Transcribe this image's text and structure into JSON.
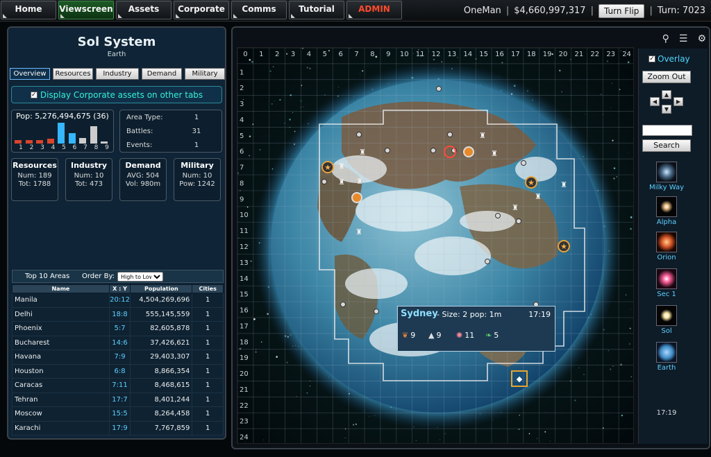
{
  "nav": {
    "items": [
      "Home",
      "Viewscreen",
      "Assets",
      "Corporate",
      "Comms",
      "Tutorial",
      "ADMIN"
    ],
    "active": "Viewscreen",
    "user": "OneMan",
    "money": "$4,660,997,317",
    "turn_flip_label": "Turn Flip",
    "turn_label": "Turn: 7023"
  },
  "left": {
    "title": "Sol System",
    "subtitle": "Earth",
    "tabs": [
      "Overview",
      "Resources",
      "Industry",
      "Demand",
      "Military"
    ],
    "active_tab": "Overview",
    "display_assets_label": "Display Corporate assets on other tabs",
    "pop_label": "Pop: 5,276,494,675 (36)",
    "histogram": {
      "labels": [
        "1",
        "2",
        "3",
        "4",
        "5",
        "6",
        "7",
        "8",
        "9"
      ],
      "values": [
        3,
        3,
        3,
        4,
        18,
        9,
        5,
        15,
        2
      ],
      "colors": [
        "#d8452c",
        "#d8452c",
        "#d8452c",
        "#d8452c",
        "#35b6ff",
        "#35b6ff",
        "#cccccc",
        "#cccccc",
        "#cccccc"
      ]
    },
    "area": {
      "type_label": "Area Type:",
      "type_value": "1",
      "battles_label": "Battles:",
      "battles_value": "31",
      "events_label": "Events:",
      "events_value": "1"
    },
    "stats": {
      "resources": {
        "title": "Resources",
        "line1": "Num: 189",
        "line2": "Tot: 1788"
      },
      "industry": {
        "title": "Industry",
        "line1": "Num: 10",
        "line2": "Tot: 473"
      },
      "demand": {
        "title": "Demand",
        "line1": "AVG: 504",
        "line2": "Vol: 980m"
      },
      "military": {
        "title": "Military",
        "line1": "Num: 10",
        "line2": "Pow: 1242"
      }
    },
    "top_areas": {
      "title": "Top 10 Areas",
      "order_label": "Order By:",
      "order_value": "High to Low",
      "columns": [
        "Name",
        "X : Y",
        "Population",
        "Cities"
      ],
      "rows": [
        {
          "name": "Manila",
          "xy": "20:12",
          "pop": "4,504,269,696",
          "cities": "1"
        },
        {
          "name": "Delhi",
          "xy": "18:8",
          "pop": "555,145,559",
          "cities": "1"
        },
        {
          "name": "Phoenix",
          "xy": "5:7",
          "pop": "82,605,878",
          "cities": "1"
        },
        {
          "name": "Bucharest",
          "xy": "14:6",
          "pop": "37,426,621",
          "cities": "1"
        },
        {
          "name": "Havana",
          "xy": "7:9",
          "pop": "29,403,307",
          "cities": "1"
        },
        {
          "name": "Houston",
          "xy": "6:8",
          "pop": "8,866,354",
          "cities": "1"
        },
        {
          "name": "Caracas",
          "xy": "7:11",
          "pop": "8,468,615",
          "cities": "1"
        },
        {
          "name": "Tehran",
          "xy": "17:7",
          "pop": "8,401,244",
          "cities": "1"
        },
        {
          "name": "Moscow",
          "xy": "15:5",
          "pop": "8,264,458",
          "cities": "1"
        },
        {
          "name": "Karachi",
          "xy": "17:9",
          "pop": "7,767,859",
          "cities": "1"
        }
      ]
    }
  },
  "map": {
    "col_labels": [
      "0",
      "1",
      "2",
      "3",
      "4",
      "5",
      "6",
      "7",
      "8",
      "9",
      "10",
      "11",
      "12",
      "13",
      "14",
      "15",
      "16",
      "17",
      "18",
      "19",
      "20",
      "21",
      "22",
      "23",
      "24"
    ],
    "row_labels": [
      "0",
      "1",
      "2",
      "3",
      "4",
      "5",
      "6",
      "7",
      "8",
      "9",
      "10",
      "11",
      "12",
      "13",
      "14",
      "15",
      "16",
      "17",
      "18",
      "19",
      "20",
      "21",
      "22",
      "23",
      "24"
    ],
    "tooltip": {
      "name": "Sydney",
      "info": "- Size: 2  pop: 1m",
      "time": "17:19",
      "res1": "9",
      "res2": "9",
      "res3": "11",
      "res4": "5"
    }
  },
  "sidebar": {
    "overlay_label": "Overlay",
    "zoom_out_label": "Zoom Out",
    "search_label": "Search",
    "items": [
      "Milky Way",
      "Alpha",
      "Orion",
      "Sec 1",
      "Sol",
      "Earth"
    ],
    "time": "17:19"
  }
}
